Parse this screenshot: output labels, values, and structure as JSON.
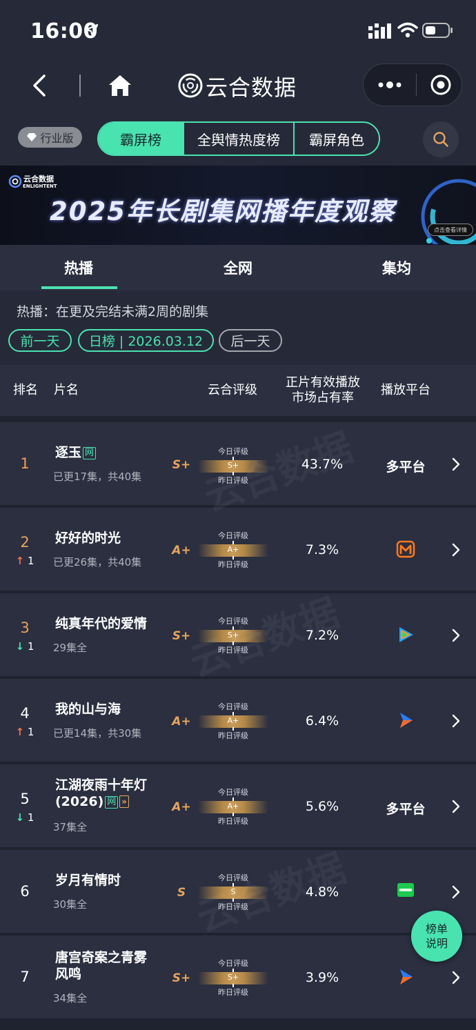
{
  "status_bar": {
    "time": "16:00"
  },
  "nav": {
    "app_title": "云合数据"
  },
  "tabs": {
    "edition": "行业版",
    "segments": [
      "霸屏榜",
      "全舆情热度榜",
      "霸屏角色"
    ],
    "active_index": 0
  },
  "banner": {
    "logo_cn": "云合数据",
    "logo_en": "ENLIGHTENT",
    "title": "2025年长剧集网播年度观察",
    "cta": "点击查看详情"
  },
  "sub_tabs": [
    "热播",
    "全网",
    "集均"
  ],
  "filter": {
    "note": "热播：在更及完结未满2周的剧集",
    "prev_day": "前一天",
    "date_label": "日榜 | 2026.03.12",
    "next_day": "后一天"
  },
  "table_header": {
    "rank": "排名",
    "title": "片名",
    "grade": "云合评级",
    "share_line1": "正片有效播放",
    "share_line2": "市场占有率",
    "platform": "播放平台"
  },
  "grade_labels": {
    "today": "今日评级",
    "yesterday": "昨日评级"
  },
  "rows": [
    {
      "rank": "1",
      "change": "",
      "title": "逐玉",
      "tag": "网",
      "tag2": "",
      "subtitle": "已更17集，共40集",
      "grade": "S+",
      "grade_bar": "S+",
      "share": "43.7%",
      "platform": "多平台",
      "platform_icon": ""
    },
    {
      "rank": "2",
      "change": "1",
      "title": "好好的时光",
      "tag": "",
      "tag2": "",
      "subtitle": "已更26集，共40集",
      "grade": "A+",
      "grade_bar": "A+",
      "share": "7.3%",
      "platform": "",
      "platform_icon": "mango-tv-icon"
    },
    {
      "rank": "3",
      "change": "1",
      "title": "纯真年代的爱情",
      "tag": "",
      "tag2": "",
      "subtitle": "29集全",
      "grade": "S+",
      "grade_bar": "S+",
      "share": "7.2%",
      "platform": "",
      "platform_icon": "tencent-video-icon"
    },
    {
      "rank": "4",
      "change": "1",
      "title": "我的山与海",
      "tag": "",
      "tag2": "",
      "subtitle": "已更14集，共30集",
      "grade": "A+",
      "grade_bar": "A+",
      "share": "6.4%",
      "platform": "",
      "platform_icon": "youku-icon"
    },
    {
      "rank": "5",
      "change": "1",
      "title": "江湖夜雨十年灯",
      "title2": "(2026)",
      "tag": "网",
      "tag2": "»",
      "subtitle": "37集全",
      "grade": "A+",
      "grade_bar": "A+",
      "share": "5.6%",
      "platform": "多平台",
      "platform_icon": ""
    },
    {
      "rank": "6",
      "change": "",
      "title": "岁月有情时",
      "tag": "",
      "tag2": "",
      "subtitle": "30集全",
      "grade": "S",
      "grade_bar": "S",
      "share": "4.8%",
      "platform": "",
      "platform_icon": "iqiyi-icon"
    },
    {
      "rank": "7",
      "change": "",
      "title": "唐宫奇案之青雾",
      "title2": "风鸣",
      "tag": "",
      "tag2": "",
      "subtitle": "34集全",
      "grade": "S+",
      "grade_bar": "S+",
      "share": "3.9%",
      "platform": "",
      "platform_icon": "youku-icon"
    }
  ],
  "watermark": {
    "cn": "云合数据",
    "en": "ENLIGHTENT"
  },
  "float_button": {
    "line1": "榜单",
    "line2": "说明"
  },
  "colors": {
    "accent": "#49e3b0",
    "gold": "#e9a45a",
    "up": "#f0734a",
    "background": "#1f232f"
  }
}
